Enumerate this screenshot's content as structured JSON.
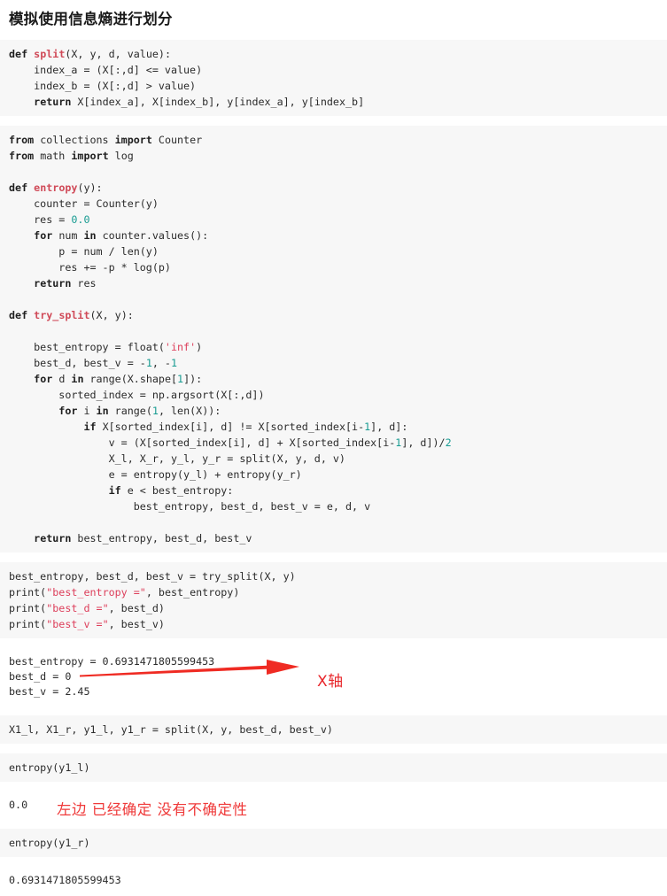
{
  "notebook": {
    "title": "模拟使用信息熵进行划分",
    "cells": [
      {
        "kind": "code",
        "name": "cell-split-function",
        "code_html": "<span class=\"k\">def</span> <span class=\"fn\">split</span>(X, y, d, value):\n    index_a = (X[:,d] &lt;= value)\n    index_b = (X[:,d] &gt; value)\n    <span class=\"k\">return</span> X[index_a], X[index_b], y[index_a], y[index_b]",
        "code_text": "def split(X, y, d, value):\n    index_a = (X[:,d] <= value)\n    index_b = (X[:,d] > value)\n    return X[index_a], X[index_b], y[index_a], y[index_b]"
      },
      {
        "kind": "code",
        "name": "cell-entropy-function",
        "code_html": "<span class=\"k\">from</span> collections <span class=\"k\">import</span> Counter\n<span class=\"k\">from</span> math <span class=\"k\">import</span> log\n\n<span class=\"k\">def</span> <span class=\"fn\">entropy</span>(y):\n    counter = Counter(y)\n    res = <span class=\"n\">0.0</span>\n    <span class=\"k\">for</span> num <span class=\"k\">in</span> counter.values():\n        p = num / len(y)\n        res += -p * log(p)\n    <span class=\"k\">return</span> res\n\n<span class=\"k\">def</span> <span class=\"fn\">try_split</span>(X, y):\n\n    best_entropy = float(<span class=\"s\">'inf'</span>)\n    best_d, best_v = -<span class=\"n\">1</span>, -<span class=\"n\">1</span>\n    <span class=\"k\">for</span> d <span class=\"k\">in</span> range(X.shape[<span class=\"n\">1</span>]):\n        sorted_index = np.argsort(X[:,d])\n        <span class=\"k\">for</span> i <span class=\"k\">in</span> range(<span class=\"n\">1</span>, len(X)):\n            <span class=\"k\">if</span> X[sorted_index[i], d] != X[sorted_index[i-<span class=\"n\">1</span>], d]:\n                v = (X[sorted_index[i], d] + X[sorted_index[i-<span class=\"n\">1</span>], d])/<span class=\"n\">2</span>\n                X_l, X_r, y_l, y_r = split(X, y, d, v)\n                e = entropy(y_l) + entropy(y_r)\n                <span class=\"k\">if</span> e &lt; best_entropy:\n                    best_entropy, best_d, best_v = e, d, v\n\n    <span class=\"k\">return</span> best_entropy, best_d, best_v",
        "code_text": "from collections import Counter\nfrom math import log\n\ndef entropy(y):\n    counter = Counter(y)\n    res = 0.0\n    for num in counter.values():\n        p = num / len(y)\n        res += -p * log(p)\n    return res\n\ndef try_split(X, y):\n\n    best_entropy = float('inf')\n    best_d, best_v = -1, -1\n    for d in range(X.shape[1]):\n        sorted_index = np.argsort(X[:,d])\n        for i in range(1, len(X)):\n            if X[sorted_index[i], d] != X[sorted_index[i-1], d]:\n                v = (X[sorted_index[i], d] + X[sorted_index[i-1], d])/2\n                X_l, X_r, y_l, y_r = split(X, y, d, v)\n                e = entropy(y_l) + entropy(y_r)\n                if e < best_entropy:\n                    best_entropy, best_d, best_v = e, d, v\n\n    return best_entropy, best_d, best_v"
      },
      {
        "kind": "code",
        "name": "cell-try-split-call",
        "code_html": "best_entropy, best_d, best_v = try_split(X, y)\nprint(<span class=\"s\">\"best_entropy =\"</span>, best_entropy)\nprint(<span class=\"s\">\"best_d =\"</span>, best_d)\nprint(<span class=\"s\">\"best_v =\"</span>, best_v)",
        "code_text": "best_entropy, best_d, best_v = try_split(X, y)\nprint(\"best_entropy =\", best_entropy)\nprint(\"best_d =\", best_d)\nprint(\"best_v =\", best_v)"
      },
      {
        "kind": "output",
        "name": "output-best-values",
        "code_text": "best_entropy = 0.6931471805599453\nbest_d = 0\nbest_v = 2.45"
      },
      {
        "kind": "code",
        "name": "cell-split-call",
        "code_html": "X1_l, X1_r, y1_l, y1_r = split(X, y, best_d, best_v)",
        "code_text": "X1_l, X1_r, y1_l, y1_r = split(X, y, best_d, best_v)"
      },
      {
        "kind": "code",
        "name": "cell-entropy-y1l",
        "code_html": "entropy(y1_l)",
        "code_text": "entropy(y1_l)"
      },
      {
        "kind": "output",
        "name": "output-entropy-y1l",
        "code_text": "0.0"
      },
      {
        "kind": "code",
        "name": "cell-entropy-y1r",
        "code_html": "entropy(y1_r)",
        "code_text": "entropy(y1_r)"
      },
      {
        "kind": "output",
        "name": "output-entropy-y1r",
        "code_text": "0.6931471805599453"
      }
    ]
  },
  "annotations": {
    "x_axis_label": "X轴",
    "left_certain_label": "左边 已经确定  没有不确定性",
    "arrow_color": "#ef2b23",
    "annotation_color": "#ef3a3a"
  }
}
